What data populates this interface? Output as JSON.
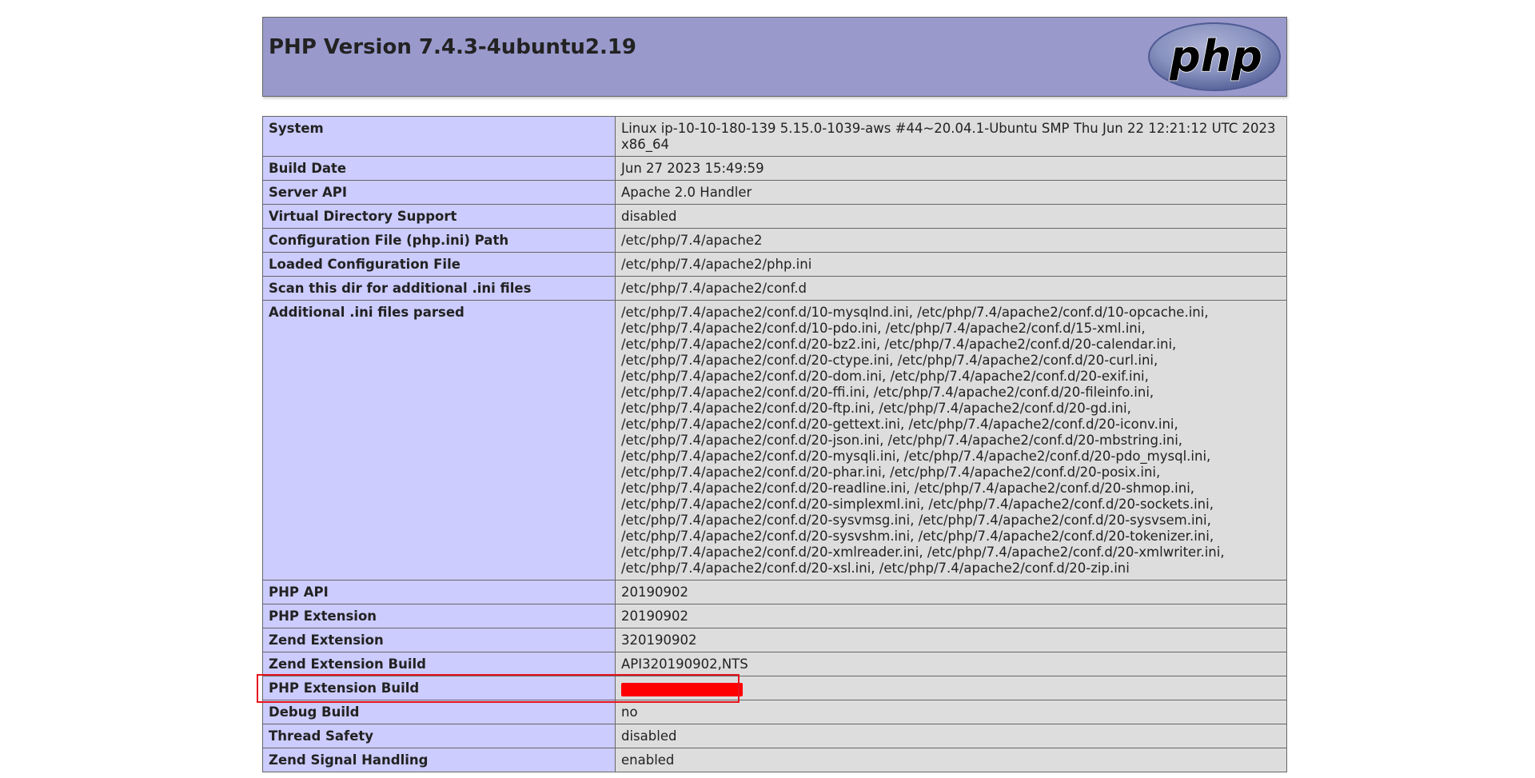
{
  "header": {
    "title": "PHP Version 7.4.3-4ubuntu2.19",
    "logo_text": "php"
  },
  "rows": [
    {
      "key": "System",
      "value": "Linux ip-10-10-180-139 5.15.0-1039-aws #44~20.04.1-Ubuntu SMP Thu Jun 22 12:21:12 UTC 2023 x86_64"
    },
    {
      "key": "Build Date",
      "value": "Jun 27 2023 15:49:59"
    },
    {
      "key": "Server API",
      "value": "Apache 2.0 Handler"
    },
    {
      "key": "Virtual Directory Support",
      "value": "disabled"
    },
    {
      "key": "Configuration File (php.ini) Path",
      "value": "/etc/php/7.4/apache2"
    },
    {
      "key": "Loaded Configuration File",
      "value": "/etc/php/7.4/apache2/php.ini"
    },
    {
      "key": "Scan this dir for additional .ini files",
      "value": "/etc/php/7.4/apache2/conf.d"
    },
    {
      "key": "Additional .ini files parsed",
      "value": "/etc/php/7.4/apache2/conf.d/10-mysqlnd.ini, /etc/php/7.4/apache2/conf.d/10-opcache.ini, /etc/php/7.4/apache2/conf.d/10-pdo.ini, /etc/php/7.4/apache2/conf.d/15-xml.ini, /etc/php/7.4/apache2/conf.d/20-bz2.ini, /etc/php/7.4/apache2/conf.d/20-calendar.ini, /etc/php/7.4/apache2/conf.d/20-ctype.ini, /etc/php/7.4/apache2/conf.d/20-curl.ini, /etc/php/7.4/apache2/conf.d/20-dom.ini, /etc/php/7.4/apache2/conf.d/20-exif.ini, /etc/php/7.4/apache2/conf.d/20-ffi.ini, /etc/php/7.4/apache2/conf.d/20-fileinfo.ini, /etc/php/7.4/apache2/conf.d/20-ftp.ini, /etc/php/7.4/apache2/conf.d/20-gd.ini, /etc/php/7.4/apache2/conf.d/20-gettext.ini, /etc/php/7.4/apache2/conf.d/20-iconv.ini, /etc/php/7.4/apache2/conf.d/20-json.ini, /etc/php/7.4/apache2/conf.d/20-mbstring.ini, /etc/php/7.4/apache2/conf.d/20-mysqli.ini, /etc/php/7.4/apache2/conf.d/20-pdo_mysql.ini, /etc/php/7.4/apache2/conf.d/20-phar.ini, /etc/php/7.4/apache2/conf.d/20-posix.ini, /etc/php/7.4/apache2/conf.d/20-readline.ini, /etc/php/7.4/apache2/conf.d/20-shmop.ini, /etc/php/7.4/apache2/conf.d/20-simplexml.ini, /etc/php/7.4/apache2/conf.d/20-sockets.ini, /etc/php/7.4/apache2/conf.d/20-sysvmsg.ini, /etc/php/7.4/apache2/conf.d/20-sysvsem.ini, /etc/php/7.4/apache2/conf.d/20-sysvshm.ini, /etc/php/7.4/apache2/conf.d/20-tokenizer.ini, /etc/php/7.4/apache2/conf.d/20-xmlreader.ini, /etc/php/7.4/apache2/conf.d/20-xmlwriter.ini, /etc/php/7.4/apache2/conf.d/20-xsl.ini, /etc/php/7.4/apache2/conf.d/20-zip.ini"
    },
    {
      "key": "PHP API",
      "value": "20190902"
    },
    {
      "key": "PHP Extension",
      "value": "20190902"
    },
    {
      "key": "Zend Extension",
      "value": "320190902"
    },
    {
      "key": "Zend Extension Build",
      "value": "API320190902,NTS"
    },
    {
      "key": "PHP Extension Build",
      "value": ""
    },
    {
      "key": "Debug Build",
      "value": "no"
    },
    {
      "key": "Thread Safety",
      "value": "disabled"
    },
    {
      "key": "Zend Signal Handling",
      "value": "enabled"
    }
  ],
  "colors": {
    "header_bg": "#9999cc",
    "key_bg": "#ccccff",
    "value_bg": "#dddddd",
    "highlight": "#e8131b",
    "redaction": "#ff0000"
  }
}
